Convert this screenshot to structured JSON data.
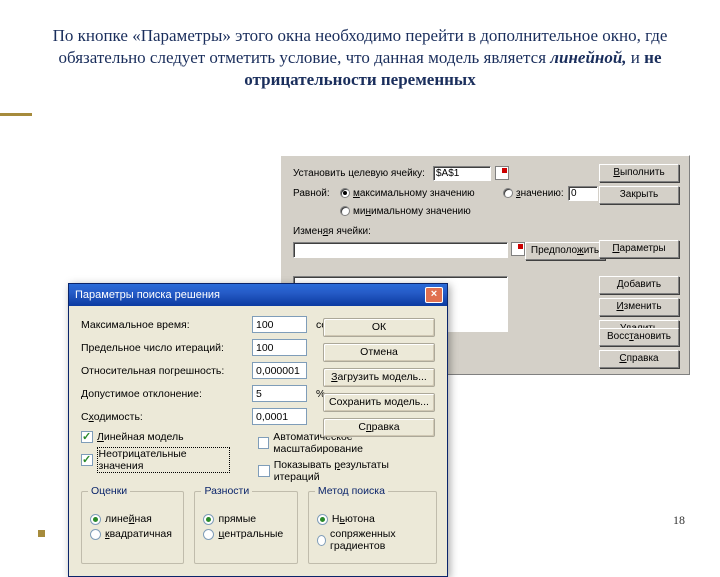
{
  "slide": {
    "caption_pre": "По кнопке «Параметры» этого окна необходимо перейти в дополнительное окно, где обязательно следует отметить условие, что данная модель является ",
    "caption_em": "линейной,",
    "caption_mid": " и ",
    "caption_b": "не отрицательности переменных",
    "page": "18"
  },
  "solver": {
    "targetLabel": "Установить целевую ячейку:",
    "targetValue": "$A$1",
    "equalLabel": "Равной:",
    "optMax": "максимальному значению",
    "optMin": "минимальному значению",
    "optVal": "значению:",
    "valValue": "0",
    "changingLabel": "Изменяя ячейки:",
    "btnRun": "Выполнить",
    "btnClose": "Закрыть",
    "btnGuess": "Предположить",
    "btnParams": "Параметры",
    "btnAdd": "Добавить",
    "btnEdit": "Изменить",
    "btnDelete": "Удалить",
    "btnRestore": "Восстановить",
    "btnHelp": "Справка"
  },
  "params": {
    "title": "Параметры поиска решения",
    "rows": {
      "maxTimeLabel": "Максимальное время:",
      "maxTimeValue": "100",
      "maxTimeUnit": "секунд",
      "iterLabel": "Предельное число итераций:",
      "iterValue": "100",
      "precLabel": "Относительная погрешность:",
      "precValue": "0,000001",
      "tolLabel": "Допустимое отклонение:",
      "tolValue": "5",
      "tolUnit": "%",
      "convLabel": "Сходимость:",
      "convValue": "0,0001"
    },
    "buttons": {
      "ok": "ОК",
      "cancel": "Отмена",
      "load": "Загрузить модель...",
      "save": "Сохранить модель...",
      "help": "Справка"
    },
    "checks": {
      "linear": "Линейная модель",
      "nonneg": "Неотрицательные значения",
      "autoscale": "Автоматическое масштабирование",
      "showiter": "Показывать результаты итераций"
    },
    "groups": {
      "est": {
        "title": "Оценки",
        "opt1": "линейная",
        "opt2": "квадратичная"
      },
      "diff": {
        "title": "Разности",
        "opt1": "прямые",
        "opt2": "центральные"
      },
      "search": {
        "title": "Метод поиска",
        "opt1": "Ньютона",
        "opt2": "сопряженных градиентов"
      }
    }
  }
}
